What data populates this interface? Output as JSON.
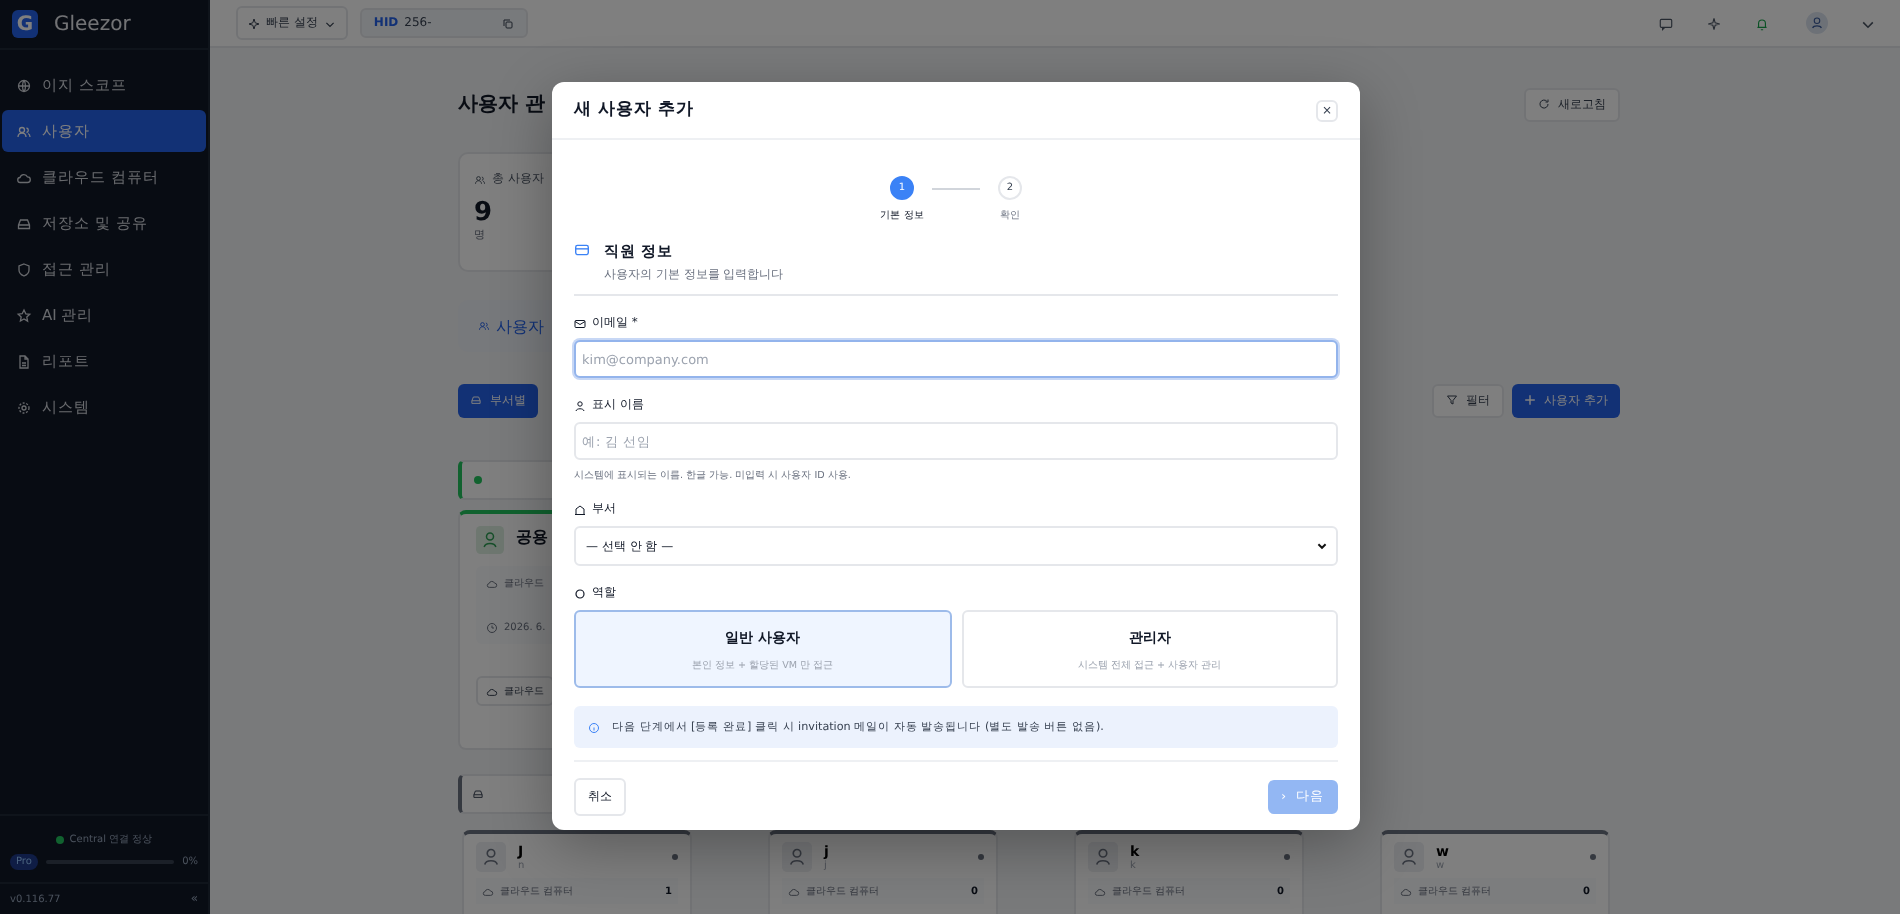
{
  "sidebar": {
    "logo_letter": "G",
    "brand": "Gleezor",
    "items": [
      {
        "label": "이지 스코프",
        "selected": false
      },
      {
        "label": "사용자",
        "selected": true
      },
      {
        "label": "클라우드 컴퓨터",
        "selected": false
      },
      {
        "label": "저장소 및 공유",
        "selected": false
      },
      {
        "label": "접근 관리",
        "selected": false
      },
      {
        "label": "AI 관리",
        "selected": false
      },
      {
        "label": "리포트",
        "selected": false
      },
      {
        "label": "시스템",
        "selected": false
      }
    ],
    "connection": "Central 연결 정상",
    "plan": "Pro",
    "usage": {
      "level": 0,
      "reading": "0%"
    },
    "version": "v0.116.77",
    "collapse": "«"
  },
  "topbar": {
    "quick_settings": "빠른 설정",
    "hid_label": "HID",
    "hid_value": "256-"
  },
  "page": {
    "title": "사용자 관",
    "refresh": "새로고침",
    "stat": {
      "label": "총 사용자",
      "value": "9",
      "unit": "명"
    },
    "tab": "사용자",
    "group_button": "부서별",
    "filter": "필터",
    "add_user": "사용자 추가",
    "group": {
      "name": "공용",
      "line_1": "클라우드",
      "date": "2026. 6.",
      "button": "클라우드"
    },
    "users": [
      {
        "name": "J",
        "sub": "n",
        "resource": "클라우드 컴퓨터",
        "count": "1"
      },
      {
        "name": "j",
        "sub": "j",
        "resource": "클라우드 컴퓨터",
        "count": "0"
      },
      {
        "name": "k",
        "sub": "k",
        "resource": "클라우드 컴퓨터",
        "count": "0"
      },
      {
        "name": "w",
        "sub": "w",
        "resource": "클라우드 컴퓨터",
        "count": "0"
      }
    ]
  },
  "modal": {
    "title": "새 사용자 추가",
    "close": "×",
    "steps": [
      {
        "number": "1",
        "label": "기본 정보",
        "selected": true
      },
      {
        "number": "2",
        "label": "확인",
        "selected": false
      }
    ],
    "section_title": "직원 정보",
    "section_subtitle": "사용자의 기본 정보를 입력합니다",
    "email": {
      "label": "이메일 *",
      "placeholder": "kim@company.com"
    },
    "display_name": {
      "label": "표시 이름",
      "placeholder": "예: 김 선임",
      "hint": "시스템에 표시되는 이름. 한글 가능. 미입력 시 사용자 ID 사용."
    },
    "department": {
      "label": "부서",
      "value": "— 선택 안 함 —"
    },
    "role": {
      "label": "역할",
      "options": [
        {
          "title": "일반 사용자",
          "desc": "본인 정보 + 할당된 VM 만 접근",
          "selected": true
        },
        {
          "title": "관리자",
          "desc": "시스템 전체 접근 + 사용자 관리",
          "selected": false
        }
      ]
    },
    "notice": "다음 단계에서 [등록 완료] 클릭 시 invitation 메일이 자동 발송됩니다 (별도 발송 버튼 없음).",
    "cancel": "취소",
    "next_icon": "›",
    "next": "다음",
    "next_disabled": true
  }
}
